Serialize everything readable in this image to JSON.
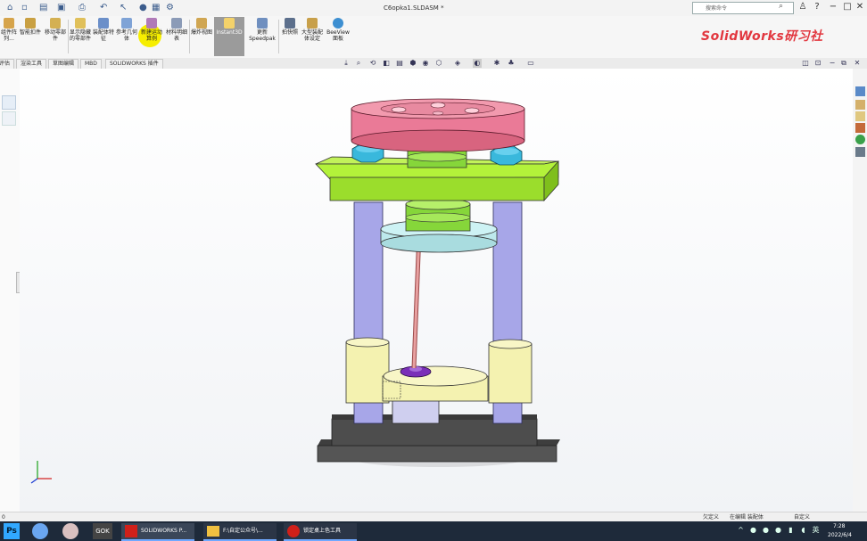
{
  "titlebar": {
    "document_title": "C6opka1.SLDASM *",
    "search_placeholder": "搜索命令",
    "help": "?",
    "minimize": "−",
    "restore": "□",
    "close": "✕"
  },
  "ribbon": {
    "buttons": [
      {
        "label": "组件阵列..."
      },
      {
        "label": "智能扣件"
      },
      {
        "label": "移动零部件"
      },
      {
        "label": "显示隐藏的零部件"
      },
      {
        "label": "装配体特征"
      },
      {
        "label": "参考几何体"
      },
      {
        "label": "新建运动算例"
      },
      {
        "label": "材料明细表"
      },
      {
        "label": "爆炸视图"
      },
      {
        "label": "Instant3D"
      },
      {
        "label": "更新Speedpak"
      },
      {
        "label": "拍快照"
      },
      {
        "label": "大型装配体设定"
      },
      {
        "label": "BeeView面板"
      }
    ],
    "brand_watermark": "SolidWorks研习社"
  },
  "command_tabs": [
    {
      "label": "评估"
    },
    {
      "label": "渲染工具"
    },
    {
      "label": "草图编辑"
    },
    {
      "label": "MBD"
    },
    {
      "label": "SOLIDWORKS 插件"
    }
  ],
  "status_bar": {
    "left_text": "0",
    "state_custom": "欠定义",
    "editing": "在编辑 装配体",
    "units": "自定义"
  },
  "taskbar": {
    "tasks": [
      {
        "label": "SOLIDWORKS P..."
      },
      {
        "label": "F:\\自定公众号\\..."
      },
      {
        "label": "锁定桌上色工具"
      }
    ],
    "time": "7:28",
    "date": "2022/6/4"
  },
  "colors": {
    "flywheel": "#ea7a97",
    "green_plate": "#b3f23a",
    "cyan_disc": "#bde9ec",
    "columns": "#a7a6e8",
    "yellow_parts": "#f4f2b0",
    "base": "#4d4d4d",
    "nuts": "#39b8dc",
    "brand_red": "#e2373f"
  }
}
